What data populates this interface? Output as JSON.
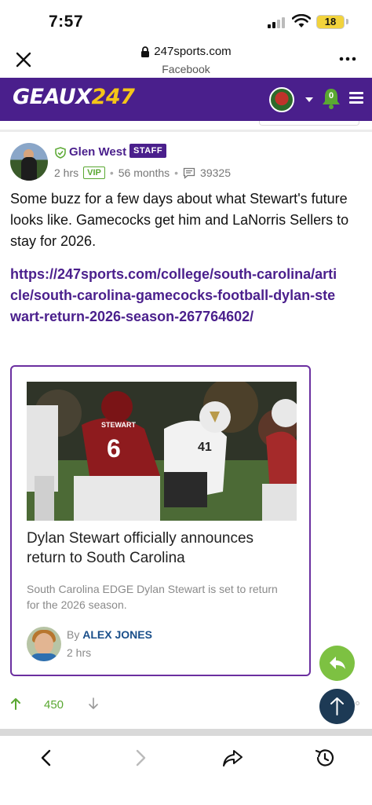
{
  "status_bar": {
    "time": "7:57",
    "battery": "18"
  },
  "browser": {
    "domain": "247sports.com",
    "source": "Facebook"
  },
  "site": {
    "logo_text": "GEAUX",
    "logo_number": "247",
    "notification_count": "0",
    "brand_color": "#4a1f8c",
    "accent_color": "#f5c518"
  },
  "post": {
    "author": "Glen West",
    "badge": "STAFF",
    "time": "2 hrs",
    "vip": "VIP",
    "tenure": "56 months",
    "post_count": "39325",
    "text": "Some buzz for a few days about what Stewart's future looks like. Gamecocks get him and LaNorris Sellers to stay for 2026.",
    "link": "https://247sports.com/college/south-carolina/article/south-carolina-gamecocks-football-dylan-stewart-return-2026-season-267764602/",
    "votes": "450"
  },
  "article": {
    "title": "Dylan Stewart officially announces return to South Carolina",
    "description": "South Carolina EDGE Dylan Stewart is set to return for the 2026 season.",
    "by_prefix": "By",
    "author": "ALEX JONES",
    "time": "2 hrs",
    "image_jersey_name": "STEWART",
    "image_jersey_number": "6",
    "image_opponent_number": "41"
  }
}
